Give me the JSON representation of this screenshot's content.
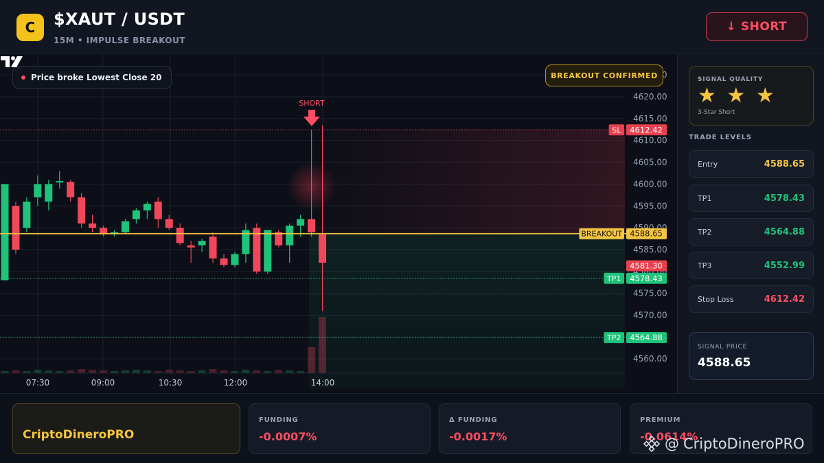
{
  "header": {
    "logo_letter": "C",
    "pair": "$XAUT / USDT",
    "subtitle": "15M • IMPULSE BREAKOUT",
    "short_button": "↓ SHORT"
  },
  "chart_overlay": {
    "legend_text": "Price broke Lowest Close 20",
    "confirm_badge": "BREAKOUT CONFIRMED",
    "short_marker": "SHORT"
  },
  "chart_data": {
    "type": "candlestick",
    "y_axis": {
      "ticks": [
        "4620.00",
        "4615.00",
        "4610.00",
        "4605.00",
        "4600.00",
        "4595.00",
        "4590.00",
        "4585.00",
        "4580.00",
        "4575.00",
        "4570.00",
        "4565.00",
        "4560.00"
      ],
      "partial_top_tick": "4625.00",
      "range": [
        4557,
        4626
      ]
    },
    "x_axis": {
      "ticks": [
        "07:30",
        "09:00",
        "10:30",
        "12:00",
        "14:00"
      ]
    },
    "price_lines": [
      {
        "label": "SL",
        "value": "4612.42",
        "color": "#f0475a"
      },
      {
        "label": "BREAKOUT",
        "value": "4588.65",
        "color": "#f5c542"
      },
      {
        "label": "",
        "value": "4581.30",
        "color": "#f0475a"
      },
      {
        "label": "TP1",
        "value": "4578.43",
        "color": "#1fc27a"
      },
      {
        "label": "TP2",
        "value": "4564.88",
        "color": "#1fc27a"
      }
    ],
    "candles_ohlc": [
      [
        4578.0,
        4600.0,
        4578.0,
        4600.0
      ],
      [
        4595.0,
        4596.0,
        4584.0,
        4585.0
      ],
      [
        4590.0,
        4597.0,
        4589.0,
        4596.0
      ],
      [
        4597.0,
        4602.0,
        4595.0,
        4600.0
      ],
      [
        4596.0,
        4601.0,
        4594.0,
        4600.0
      ],
      [
        4600.5,
        4603.0,
        4599.0,
        4600.7
      ],
      [
        4600.5,
        4601.0,
        4596.0,
        4597.0
      ],
      [
        4597.0,
        4598.0,
        4590.0,
        4591.0
      ],
      [
        4591.0,
        4593.0,
        4589.0,
        4590.0
      ],
      [
        4590.0,
        4590.5,
        4588.0,
        4588.5
      ],
      [
        4588.5,
        4589.5,
        4588.0,
        4589.0
      ],
      [
        4589.0,
        4592.0,
        4588.5,
        4591.5
      ],
      [
        4592.0,
        4594.5,
        4591.0,
        4594.0
      ],
      [
        4594.0,
        4596.0,
        4592.0,
        4595.5
      ],
      [
        4596.0,
        4597.0,
        4590.0,
        4592.0
      ],
      [
        4592.0,
        4593.0,
        4589.5,
        4590.0
      ],
      [
        4590.0,
        4591.0,
        4586.0,
        4586.5
      ],
      [
        4586.0,
        4587.0,
        4582.0,
        4585.5
      ],
      [
        4586.0,
        4587.5,
        4584.5,
        4587.0
      ],
      [
        4588.0,
        4589.0,
        4582.0,
        4583.0
      ],
      [
        4583.0,
        4584.0,
        4581.0,
        4581.5
      ],
      [
        4581.5,
        4584.5,
        4581.0,
        4584.0
      ],
      [
        4584.0,
        4591.0,
        4582.0,
        4589.5
      ],
      [
        4590.0,
        4591.0,
        4579.5,
        4580.0
      ],
      [
        4580.0,
        4589.5,
        4579.5,
        4589.5
      ],
      [
        4589.0,
        4589.5,
        4585.5,
        4586.0
      ],
      [
        4586.0,
        4591.0,
        4582.0,
        4590.5
      ],
      [
        4590.5,
        4593.0,
        4588.0,
        4592.0
      ],
      [
        4592.0,
        4612.4,
        4588.0,
        4589.0
      ],
      [
        4588.5,
        4613.5,
        4571.0,
        4582.0
      ]
    ],
    "grid": true
  },
  "sidebar": {
    "quality_label": "SIGNAL QUALITY",
    "stars": "★ ★ ★",
    "stars_caption": "3-Star Short",
    "levels_title": "TRADE LEVELS",
    "levels": [
      {
        "name": "Entry",
        "value": "4588.65",
        "color": "#f5c542"
      },
      {
        "name": "TP1",
        "value": "4578.43",
        "color": "#1fc27a"
      },
      {
        "name": "TP2",
        "value": "4564.88",
        "color": "#1fc27a"
      },
      {
        "name": "TP3",
        "value": "4552.99",
        "color": "#1fc27a"
      },
      {
        "name": "Stop Loss",
        "value": "4612.42",
        "color": "#ff4d63"
      }
    ],
    "signal_price_label": "SIGNAL PRICE",
    "signal_price": "4588.65"
  },
  "footer": {
    "brand": "CriptoDineroPRO",
    "metrics": [
      {
        "label": "FUNDING",
        "value": "-0.0007%"
      },
      {
        "label": "Δ FUNDING",
        "value": "-0.0017%"
      },
      {
        "label": "PREMIUM",
        "value": "-0.0614%"
      }
    ],
    "watermark": "CriptoDineroPRO",
    "watermark_at": "@"
  }
}
